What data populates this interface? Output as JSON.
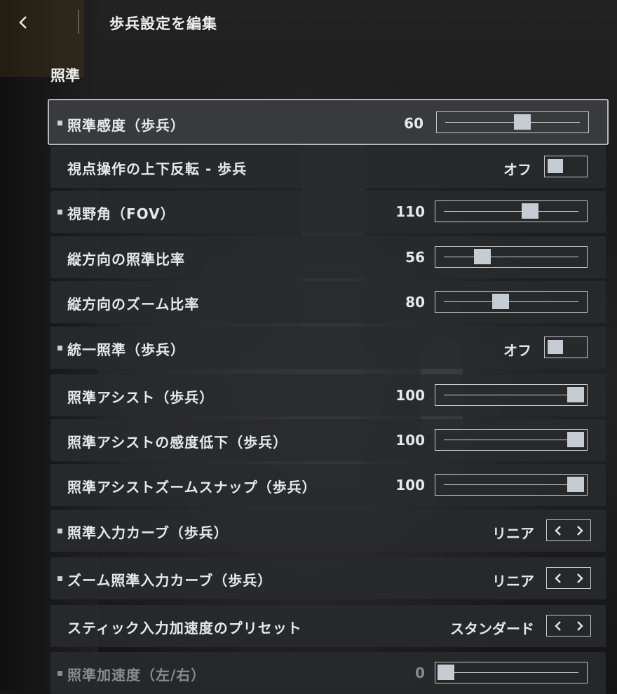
{
  "header": {
    "title": "歩兵設定を編集"
  },
  "section": {
    "title": "照準"
  },
  "rows": [
    {
      "label": "照準感度（歩兵）",
      "value": "60",
      "slider_fraction": 0.58,
      "dot": true,
      "selected": true
    },
    {
      "label": "視点操作の上下反転 - 歩兵",
      "toggle_value": "オフ",
      "dot": false
    },
    {
      "label": "視野角（FOV）",
      "value": "110",
      "slider_fraction": 0.65,
      "dot": true
    },
    {
      "label": "縦方向の照準比率",
      "value": "56",
      "slider_fraction": 0.28,
      "dot": false
    },
    {
      "label": "縦方向のズーム比率",
      "value": "80",
      "slider_fraction": 0.42,
      "dot": false
    },
    {
      "label": "統一照準（歩兵）",
      "toggle_value": "オフ",
      "dot": true
    },
    {
      "label": "照準アシスト（歩兵）",
      "value": "100",
      "slider_fraction": 1.0,
      "dot": false
    },
    {
      "label": "照準アシストの感度低下（歩兵）",
      "value": "100",
      "slider_fraction": 1.0,
      "dot": false
    },
    {
      "label": "照準アシストズームスナップ（歩兵）",
      "value": "100",
      "slider_fraction": 1.0,
      "dot": false
    },
    {
      "label": "照準入力カーブ（歩兵）",
      "stepper_value": "リニア",
      "dot": true
    },
    {
      "label": "ズーム照準入力カーブ（歩兵）",
      "stepper_value": "リニア",
      "dot": true
    },
    {
      "label": "スティック入力加速度のプリセット",
      "stepper_value": "スタンダード",
      "dot": false
    },
    {
      "label": "照準加速度（左/右）",
      "value": "0",
      "slider_fraction": 0.0,
      "dot": true,
      "dimmed": true
    }
  ],
  "icons": {
    "back": "chevron-left-icon",
    "prev": "chevron-left-icon",
    "next": "chevron-right-icon"
  },
  "colors": {
    "thumb": "#c5ccd3",
    "row_bg": "#282a2c",
    "selected_border": "#b8b8b8"
  }
}
